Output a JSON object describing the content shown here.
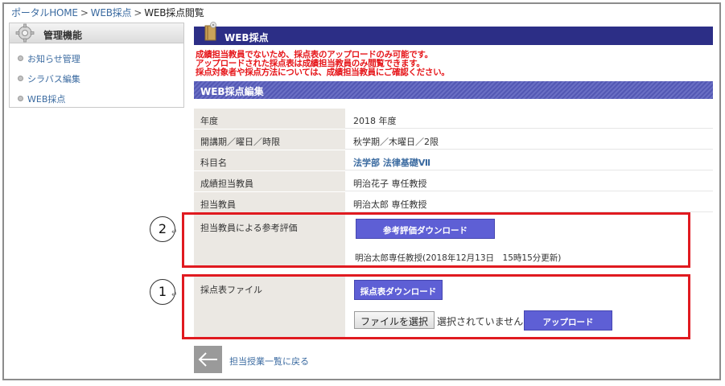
{
  "breadcrumb": {
    "home": "ポータルHOME",
    "web_grading": "WEB採点",
    "current": "WEB採点閲覧",
    "sep": ">"
  },
  "sidebar": {
    "title": "管理機能",
    "items": [
      {
        "label": "お知らせ管理"
      },
      {
        "label": "シラバス編集"
      },
      {
        "label": "WEB採点"
      }
    ]
  },
  "main": {
    "title": "WEB採点",
    "warning_lines": [
      "成績担当教員でないため、採点表のアップロードのみ可能です。",
      "アップロードされた採点表は成績担当教員のみ閲覧できます。",
      "採点対象者や採点方法については、成績担当教員にご確認ください。"
    ],
    "section_title": "WEB採点編集"
  },
  "info_rows": [
    {
      "label": "年度",
      "value": "2018 年度"
    },
    {
      "label": "開講期／曜日／時限",
      "value": "秋学期／木曜日／2限"
    },
    {
      "label": "科目名",
      "value": "法学部 法律基礎Ⅶ"
    },
    {
      "label": "成績担当教員",
      "value": "明治花子 専任教授"
    },
    {
      "label": "担当教員",
      "value": "明治太郎 専任教授"
    }
  ],
  "reference_eval": {
    "label": "担当教員による参考評価",
    "download_label": "参考評価ダウンロード",
    "updated_text": "明治太郎専任教授(2018年12月13日　15時15分更新)"
  },
  "grading_file": {
    "label": "採点表ファイル",
    "download_label": "採点表ダウンロード",
    "choose_file_label": "ファイルを選択",
    "no_file_text": "選択されていません",
    "upload_label": "アップロード"
  },
  "annotations": {
    "circle_1": "1",
    "circle_2": "2",
    "return_mark": "↵"
  },
  "back_link": "担当授業一覧に戻る",
  "colors": {
    "header_navy": "#2c2e86",
    "button_blue": "#5e5fd5",
    "warning_red": "#e6161a",
    "highlight_red": "#e01a20",
    "link_blue": "#3a6aa0"
  }
}
